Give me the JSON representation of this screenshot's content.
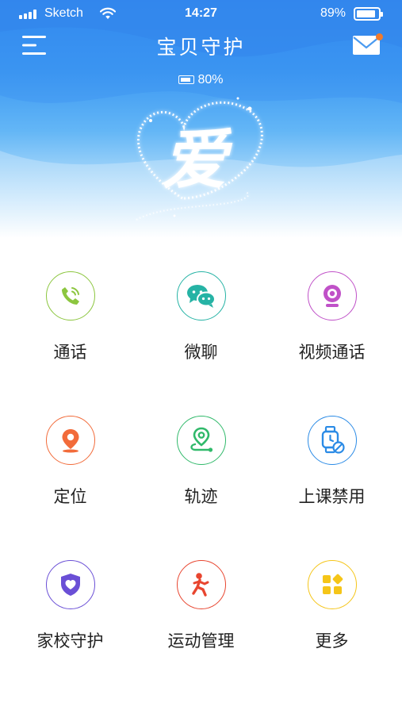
{
  "status_bar": {
    "carrier": "Sketch",
    "time": "14:27",
    "battery": "89%"
  },
  "header": {
    "title": "宝贝守护",
    "device_battery": "80%",
    "heart_text": "爱",
    "menu_icon": "menu-icon",
    "mail_icon": "mail-icon"
  },
  "features": [
    {
      "label": "通话",
      "icon": "phone-icon",
      "color": "#8cc63f"
    },
    {
      "label": "微聊",
      "icon": "wechat-icon",
      "color": "#26b3a5"
    },
    {
      "label": "视频通话",
      "icon": "webcam-icon",
      "color": "#c051c8"
    },
    {
      "label": "定位",
      "icon": "location-pin-icon",
      "color": "#f26b3a"
    },
    {
      "label": "轨迹",
      "icon": "route-icon",
      "color": "#30b96a"
    },
    {
      "label": "上课禁用",
      "icon": "watch-disable-icon",
      "color": "#2b8be6"
    },
    {
      "label": "家校守护",
      "icon": "shield-heart-icon",
      "color": "#6a4fd6"
    },
    {
      "label": "运动管理",
      "icon": "running-icon",
      "color": "#e8452f"
    },
    {
      "label": "更多",
      "icon": "more-grid-icon",
      "color": "#f5c518"
    }
  ]
}
